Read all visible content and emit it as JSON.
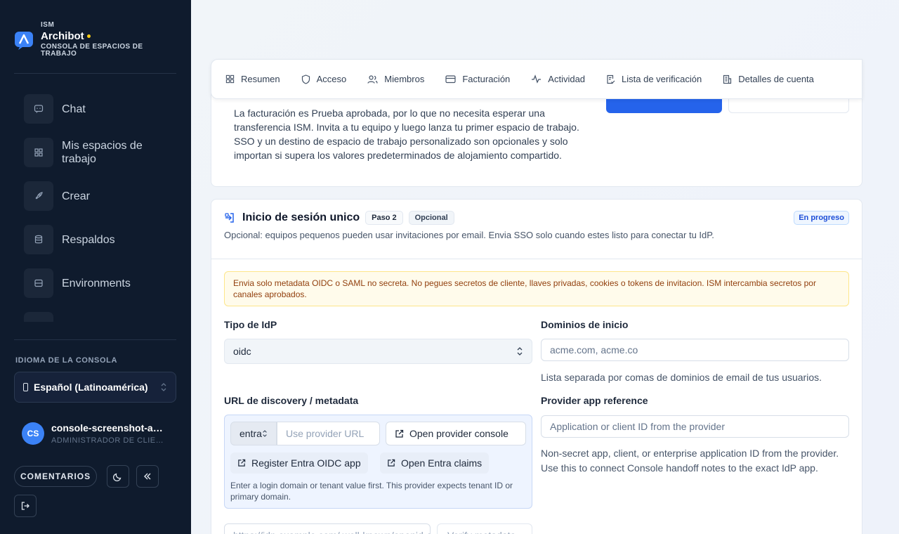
{
  "brand": {
    "org": "ISM",
    "name": "Archibot",
    "subtitle": "CONSOLA DE ESPACIOS DE TRABAJO"
  },
  "sidebar": {
    "items": [
      {
        "label": "Chat",
        "icon": "chat-icon"
      },
      {
        "label": "Mis espacios de trabajo",
        "icon": "grid-icon"
      },
      {
        "label": "Crear",
        "icon": "rocket-icon"
      },
      {
        "label": "Respaldos",
        "icon": "database-icon"
      },
      {
        "label": "Environments",
        "icon": "server-icon"
      }
    ],
    "language_label": "IDIOMA DE LA CONSOLA",
    "language_value": "Español (Latinoamérica)",
    "user": {
      "initials": "CS",
      "name": "console-screenshot-admin",
      "role": "ADMINISTRADOR DE CLIENTE"
    },
    "feedback_label": "COMENTARIOS"
  },
  "tabs": [
    {
      "label": "Resumen",
      "icon": "grid-icon"
    },
    {
      "label": "Acceso",
      "icon": "shield-icon"
    },
    {
      "label": "Miembros",
      "icon": "users-icon"
    },
    {
      "label": "Facturación",
      "icon": "credit-card-icon"
    },
    {
      "label": "Actividad",
      "icon": "activity-icon"
    },
    {
      "label": "Lista de verificación",
      "icon": "checklist-icon"
    },
    {
      "label": "Detalles de cuenta",
      "icon": "building-icon"
    }
  ],
  "intro_card": {
    "text": "La facturación es Prueba aprobada, por lo que no necesita esperar una transferencia ISM. Invita a tu equipo y luego lanza tu primer espacio de trabajo. SSO y un destino de espacio de trabajo personalizado son opcionales y solo importan si supera los valores predeterminados de alojamiento compartido."
  },
  "sso": {
    "title": "Inicio de sesión unico",
    "step": "Paso 2",
    "optional": "Opcional",
    "status": "En progreso",
    "description": "Opcional: equipos pequenos pueden usar invitaciones por email. Envia SSO solo cuando estes listo para conectar tu IdP.",
    "warning": "Envia solo metadata OIDC o SAML no secreta. No pegues secretos de cliente, llaves privadas, cookies o tokens de invitacion. ISM intercambia secretos por canales aprobados.",
    "idp_type_label": "Tipo de IdP",
    "idp_type_value": "oidc",
    "domains_label": "Dominios de inicio",
    "domains_placeholder": "acme.com, acme.co",
    "domains_help": "Lista separada por comas de dominios de email de tus usuarios.",
    "discovery_label": "URL de discovery / metadata",
    "provider_value": "entra",
    "provider_url_placeholder": "Use provider URL",
    "open_console_label": "Open provider console",
    "register_label": "Register Entra OIDC app",
    "claims_label": "Open Entra claims",
    "url_note": "Enter a login domain or tenant value first. This provider expects tenant ID or primary domain.",
    "app_ref_label": "Provider app reference",
    "app_ref_placeholder": "Application or client ID from the provider",
    "app_ref_help": "Non-secret app, client, or enterprise application ID from the provider. Use this to connect Console handoff notes to the exact IdP app.",
    "metadata_placeholder": "https://idp.example.com/.well-known/openid-configuration",
    "verify_label": "Verify metadata"
  },
  "colors": {
    "sidebar_bg": "#0f1b2d",
    "accent": "#2563eb",
    "warning_bg": "#fffbeb",
    "status_blue": "#1d4ed8"
  }
}
